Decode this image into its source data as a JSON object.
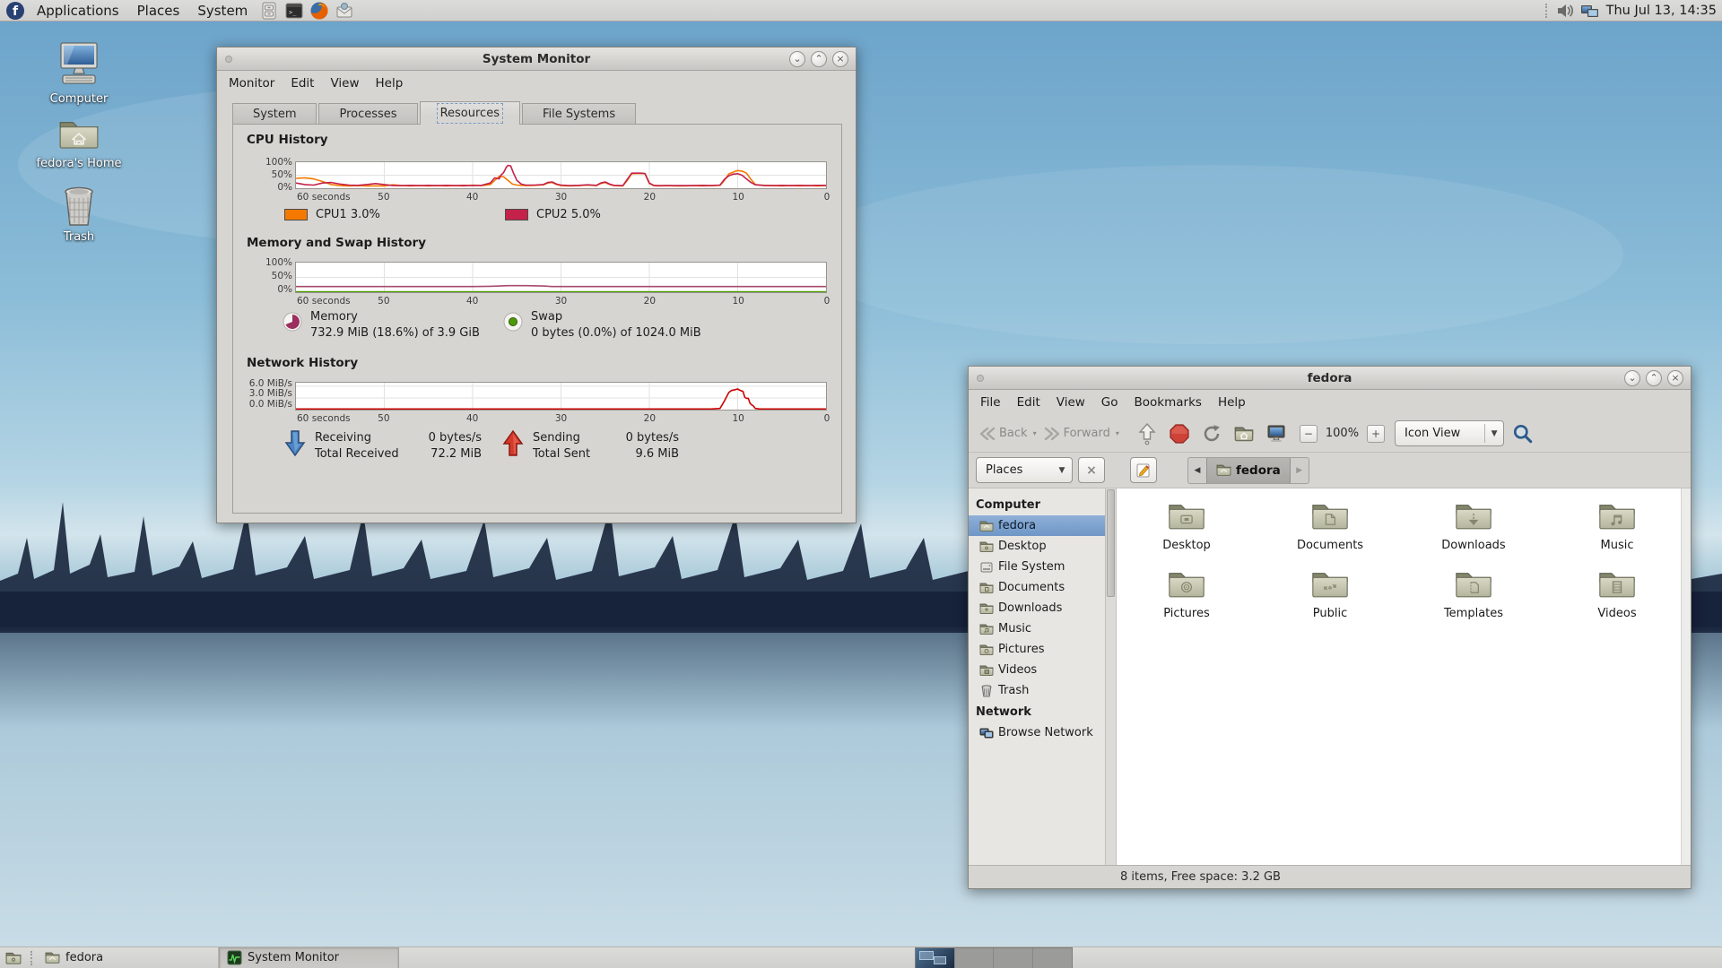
{
  "panel": {
    "menus": [
      "Applications",
      "Places",
      "System"
    ],
    "launchers": [
      "file-manager",
      "terminal",
      "firefox",
      "mail"
    ],
    "clock": "Thu Jul 13, 14:35"
  },
  "desktop_icons": [
    {
      "label": "Computer"
    },
    {
      "label": "fedora's Home"
    },
    {
      "label": "Trash"
    }
  ],
  "sysmon": {
    "title": "System Monitor",
    "menus": [
      "Monitor",
      "Edit",
      "View",
      "Help"
    ],
    "tabs": [
      "System",
      "Processes",
      "Resources",
      "File Systems"
    ],
    "active_tab": "Resources",
    "cpu": {
      "heading": "CPU History",
      "yticks": [
        "100%",
        "50%",
        "0%"
      ],
      "xticks": [
        "60 seconds",
        "50",
        "40",
        "30",
        "20",
        "10",
        "0"
      ],
      "legend": [
        {
          "label": "CPU1 3.0%",
          "color": "#f57900"
        },
        {
          "label": "CPU2 5.0%",
          "color": "#c4224a"
        }
      ]
    },
    "mem": {
      "heading": "Memory and Swap History",
      "yticks": [
        "100%",
        "50%",
        "0%"
      ],
      "xticks": [
        "60 seconds",
        "50",
        "40",
        "30",
        "20",
        "10",
        "0"
      ],
      "legend": [
        {
          "label": "Memory",
          "value": "732.9 MiB (18.6%) of 3.9 GiB",
          "color": "#9b2f5f"
        },
        {
          "label": "Swap",
          "value": "0 bytes (0.0%) of 1024.0 MiB",
          "color": "#4e9a06"
        }
      ]
    },
    "net": {
      "heading": "Network History",
      "yticks": [
        "6.0 MiB/s",
        "3.0 MiB/s",
        "0.0 MiB/s"
      ],
      "xticks": [
        "60 seconds",
        "50",
        "40",
        "30",
        "20",
        "10",
        "0"
      ],
      "legend": {
        "receiving": "Receiving",
        "receiving_value": "0 bytes/s",
        "total_received": "Total Received",
        "total_received_value": "72.2 MiB",
        "sending": "Sending",
        "sending_value": "0 bytes/s",
        "total_sent": "Total Sent",
        "total_sent_value": "9.6 MiB"
      }
    },
    "charts": {
      "cpu": {
        "type": "line",
        "x_max": 60,
        "y_max": 100,
        "hlines": [
          50
        ],
        "series": [
          {
            "name": "CPU1",
            "color": "#f57900",
            "points": [
              [
                60,
                38
              ],
              [
                59,
                40
              ],
              [
                58,
                36
              ],
              [
                57,
                26
              ],
              [
                56,
                14
              ],
              [
                55,
                10
              ],
              [
                54,
                9
              ],
              [
                53,
                10
              ],
              [
                52,
                9
              ],
              [
                50,
                9
              ],
              [
                49,
                13
              ],
              [
                48,
                10
              ],
              [
                47,
                9
              ],
              [
                46,
                10
              ],
              [
                45,
                9
              ],
              [
                44,
                10
              ],
              [
                43,
                9
              ],
              [
                42,
                10
              ],
              [
                41,
                9
              ],
              [
                40,
                12
              ],
              [
                39,
                10
              ],
              [
                38,
                14
              ],
              [
                37.5,
                30
              ],
              [
                37,
                46
              ],
              [
                36.5,
                44
              ],
              [
                36,
                30
              ],
              [
                35.5,
                16
              ],
              [
                35,
                12
              ],
              [
                34,
                10
              ],
              [
                33,
                11
              ],
              [
                32,
                13
              ],
              [
                31.5,
                20
              ],
              [
                31,
                22
              ],
              [
                30.5,
                14
              ],
              [
                30,
                10
              ],
              [
                29,
                9
              ],
              [
                28,
                10
              ],
              [
                27,
                12
              ],
              [
                26,
                10
              ],
              [
                25.5,
                18
              ],
              [
                25,
                22
              ],
              [
                24.5,
                14
              ],
              [
                24,
                10
              ],
              [
                23,
                9
              ],
              [
                22.5,
                30
              ],
              [
                22,
                56
              ],
              [
                21,
                57
              ],
              [
                20.5,
                56
              ],
              [
                20,
                18
              ],
              [
                19.5,
                10
              ],
              [
                19,
                9
              ],
              [
                18,
                10
              ],
              [
                17,
                9
              ],
              [
                16,
                9
              ],
              [
                15,
                10
              ],
              [
                14,
                9
              ],
              [
                13,
                10
              ],
              [
                12,
                11
              ],
              [
                11.5,
                30
              ],
              [
                11,
                55
              ],
              [
                10.5,
                62
              ],
              [
                10,
                68
              ],
              [
                9.5,
                66
              ],
              [
                9,
                58
              ],
              [
                8.5,
                34
              ],
              [
                8,
                14
              ],
              [
                7,
                10
              ],
              [
                6,
                10
              ],
              [
                5,
                9
              ],
              [
                4,
                10
              ],
              [
                3,
                9
              ],
              [
                2,
                10
              ],
              [
                1,
                9
              ],
              [
                0,
                10
              ]
            ]
          },
          {
            "name": "CPU2",
            "color": "#c4224a",
            "points": [
              [
                60,
                20
              ],
              [
                59,
                14
              ],
              [
                58,
                12
              ],
              [
                57,
                20
              ],
              [
                56,
                22
              ],
              [
                55,
                16
              ],
              [
                54,
                12
              ],
              [
                53,
                11
              ],
              [
                52,
                14
              ],
              [
                51,
                18
              ],
              [
                50,
                14
              ],
              [
                49,
                10
              ],
              [
                48,
                10
              ],
              [
                47,
                11
              ],
              [
                46,
                10
              ],
              [
                45,
                11
              ],
              [
                44,
                10
              ],
              [
                43,
                11
              ],
              [
                42,
                10
              ],
              [
                41,
                11
              ],
              [
                40,
                10
              ],
              [
                39,
                11
              ],
              [
                38,
                20
              ],
              [
                37.5,
                40
              ],
              [
                37,
                36
              ],
              [
                36.8,
                50
              ],
              [
                36.5,
                60
              ],
              [
                36.2,
                80
              ],
              [
                36,
                88
              ],
              [
                35.7,
                86
              ],
              [
                35.4,
                60
              ],
              [
                35,
                30
              ],
              [
                34.5,
                16
              ],
              [
                34,
                12
              ],
              [
                33,
                12
              ],
              [
                32,
                14
              ],
              [
                31.5,
                22
              ],
              [
                31,
                24
              ],
              [
                30.5,
                16
              ],
              [
                30,
                12
              ],
              [
                29,
                10
              ],
              [
                28,
                11
              ],
              [
                27,
                13
              ],
              [
                26,
                11
              ],
              [
                25.5,
                20
              ],
              [
                25,
                24
              ],
              [
                24.5,
                16
              ],
              [
                24,
                11
              ],
              [
                23,
                10
              ],
              [
                22.5,
                34
              ],
              [
                22,
                58
              ],
              [
                21,
                58
              ],
              [
                20.5,
                57
              ],
              [
                20,
                20
              ],
              [
                19.5,
                11
              ],
              [
                19,
                10
              ],
              [
                18,
                10
              ],
              [
                17,
                10
              ],
              [
                16,
                10
              ],
              [
                15,
                10
              ],
              [
                14,
                11
              ],
              [
                13,
                10
              ],
              [
                12,
                12
              ],
              [
                11.5,
                34
              ],
              [
                11,
                48
              ],
              [
                10.5,
                54
              ],
              [
                10,
                56
              ],
              [
                9.5,
                50
              ],
              [
                9,
                36
              ],
              [
                8.5,
                22
              ],
              [
                8,
                13
              ],
              [
                7,
                11
              ],
              [
                6,
                10
              ],
              [
                5,
                11
              ],
              [
                4,
                10
              ],
              [
                3,
                11
              ],
              [
                2,
                10
              ],
              [
                1,
                11
              ],
              [
                0,
                11
              ]
            ]
          }
        ]
      },
      "mem": {
        "type": "line",
        "x_max": 60,
        "y_max": 100,
        "hlines": [
          50
        ],
        "series": [
          {
            "name": "Memory",
            "color": "#a84a6e",
            "points": [
              [
                60,
                19
              ],
              [
                50,
                19
              ],
              [
                40,
                19
              ],
              [
                38,
                20
              ],
              [
                36,
                22
              ],
              [
                34,
                22
              ],
              [
                32,
                21
              ],
              [
                31,
                19
              ],
              [
                25,
                19
              ],
              [
                20,
                19
              ],
              [
                10,
                19
              ],
              [
                0,
                19
              ]
            ]
          },
          {
            "name": "Swap",
            "color": "#4e9a06",
            "points": [
              [
                60,
                1.5
              ],
              [
                0,
                1.5
              ]
            ]
          }
        ]
      },
      "net": {
        "type": "line",
        "x_max": 60,
        "y_max": 6.9,
        "hlines": [
          3,
          6
        ],
        "series": [
          {
            "name": "Network",
            "color": "#cc0000",
            "points": [
              [
                60,
                0.15
              ],
              [
                40,
                0.15
              ],
              [
                30,
                0.15
              ],
              [
                13,
                0.15
              ],
              [
                12,
                0.3
              ],
              [
                11.5,
                2.2
              ],
              [
                11,
                4.4
              ],
              [
                10.7,
                4.9
              ],
              [
                10.3,
                5.1
              ],
              [
                10,
                5.3
              ],
              [
                9.7,
                4.9
              ],
              [
                9.4,
                4.7
              ],
              [
                9.2,
                3.2
              ],
              [
                9,
                2.9
              ],
              [
                8.8,
                2.9
              ],
              [
                8.6,
                1.6
              ],
              [
                8.4,
                1.2
              ],
              [
                8.2,
                0.9
              ],
              [
                8,
                0.3
              ],
              [
                7.5,
                0.15
              ],
              [
                0,
                0.15
              ]
            ]
          }
        ]
      }
    }
  },
  "filemgr": {
    "title": "fedora",
    "menus": [
      "File",
      "Edit",
      "View",
      "Go",
      "Bookmarks",
      "Help"
    ],
    "toolbar": {
      "back": "Back",
      "forward": "Forward",
      "zoom_level": "100%",
      "view_mode": "Icon View"
    },
    "location": {
      "places": "Places",
      "breadcrumb": "fedora"
    },
    "sidebar": {
      "computer_header": "Computer",
      "items": [
        "fedora",
        "Desktop",
        "File System",
        "Documents",
        "Downloads",
        "Music",
        "Pictures",
        "Videos",
        "Trash"
      ],
      "selected": "fedora",
      "network_header": "Network",
      "network_items": [
        "Browse Network"
      ]
    },
    "folders": [
      "Desktop",
      "Documents",
      "Downloads",
      "Music",
      "Pictures",
      "Public",
      "Templates",
      "Videos"
    ],
    "statusbar": "8 items, Free space: 3.2 GB"
  },
  "taskbar": {
    "window_buttons": [
      {
        "label": "fedora",
        "active": false
      },
      {
        "label": "System Monitor",
        "active": true
      }
    ],
    "workspaces": 4
  }
}
